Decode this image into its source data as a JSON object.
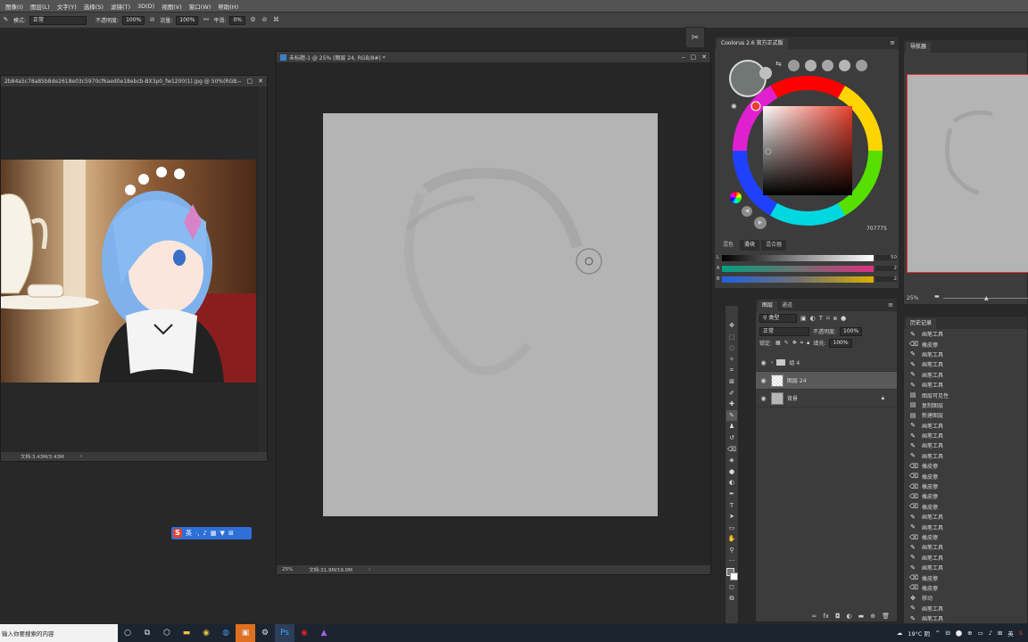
{
  "menu": [
    "图像(I)",
    "图层(L)",
    "文字(Y)",
    "选择(S)",
    "滤镜(T)",
    "3D(D)",
    "视图(V)",
    "窗口(W)",
    "帮助(H)"
  ],
  "options": {
    "mode_label": "模式:",
    "mode_value": "正常",
    "opacity_label": "不透明度:",
    "opacity_value": "100%",
    "flow_label": "流量:",
    "flow_value": "100%",
    "smooth_label": "平滑:",
    "smooth_value": "0%"
  },
  "ref_window": {
    "title": "2b84a5c78a85b8de2618e03c5970cf6aed0e18ebcb-BX3p0_fw1200(1).jpg @ 50%(RGB...",
    "status": "文档:3.43M/3.43M"
  },
  "canvas_window": {
    "title": "未标题-1 @ 25% (图层 24, RGB/8#) *",
    "zoom": "25%",
    "status": "文档:31.9M/19.0M"
  },
  "color_panel": {
    "title": "Coolorus 2.6 官方正式版",
    "hex": "707775",
    "tabs": [
      "混色",
      "滑块",
      "混合器"
    ],
    "sliders": [
      {
        "label": "L",
        "value": "50"
      },
      {
        "label": "A",
        "value": "2"
      },
      {
        "label": "B",
        "value": "2"
      }
    ]
  },
  "navigator": {
    "tab": "导航器",
    "zoom": "25%"
  },
  "layers_panel": {
    "tabs": [
      "图层",
      "通道"
    ],
    "filter_label": "类型",
    "blend": "正常",
    "opacity_label": "不透明度:",
    "opacity_value": "100%",
    "lock_label": "锁定:",
    "fill_label": "填充:",
    "fill_value": "100%",
    "layers": [
      {
        "name": "组 4",
        "type": "group"
      },
      {
        "name": "图层 24",
        "type": "layer"
      },
      {
        "name": "背景",
        "type": "background"
      }
    ]
  },
  "history_panel": {
    "tab": "历史记录",
    "items": [
      "画笔工具",
      "橡皮擦",
      "画笔工具",
      "画笔工具",
      "画笔工具",
      "画笔工具",
      "图层可见性",
      "复制图层",
      "新建图层",
      "画笔工具",
      "画笔工具",
      "画笔工具",
      "画笔工具",
      "橡皮擦",
      "橡皮擦",
      "橡皮擦",
      "橡皮擦",
      "橡皮擦",
      "画笔工具",
      "画笔工具",
      "橡皮擦",
      "画笔工具",
      "画笔工具",
      "画笔工具",
      "橡皮擦",
      "橡皮擦",
      "移动",
      "画笔工具",
      "画笔工具",
      "画笔工具"
    ]
  },
  "ime": {
    "label": "英"
  },
  "taskbar": {
    "search_placeholder": "输入你要搜索的内容",
    "weather": "19°C 阴",
    "ime": "英"
  }
}
